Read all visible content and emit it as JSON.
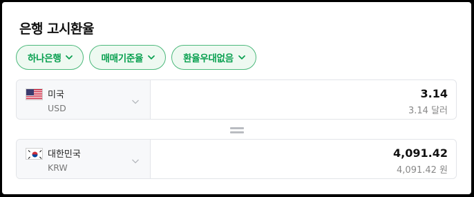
{
  "title": "은행 고시환율",
  "filters": [
    {
      "label": "하나은행"
    },
    {
      "label": "매매기준율"
    },
    {
      "label": "환율우대없음"
    }
  ],
  "from": {
    "flag": "us-flag-icon",
    "name": "미국",
    "code": "USD",
    "amount": "3.14",
    "amount_text": "3.14 달러"
  },
  "to": {
    "flag": "kr-flag-icon",
    "name": "대한민국",
    "code": "KRW",
    "amount": "4,091.42",
    "amount_text": "4,091.42 원"
  },
  "colors": {
    "accent": "#09a050",
    "chip_bg": "#eef9f1",
    "chip_border": "#4ab87a"
  }
}
